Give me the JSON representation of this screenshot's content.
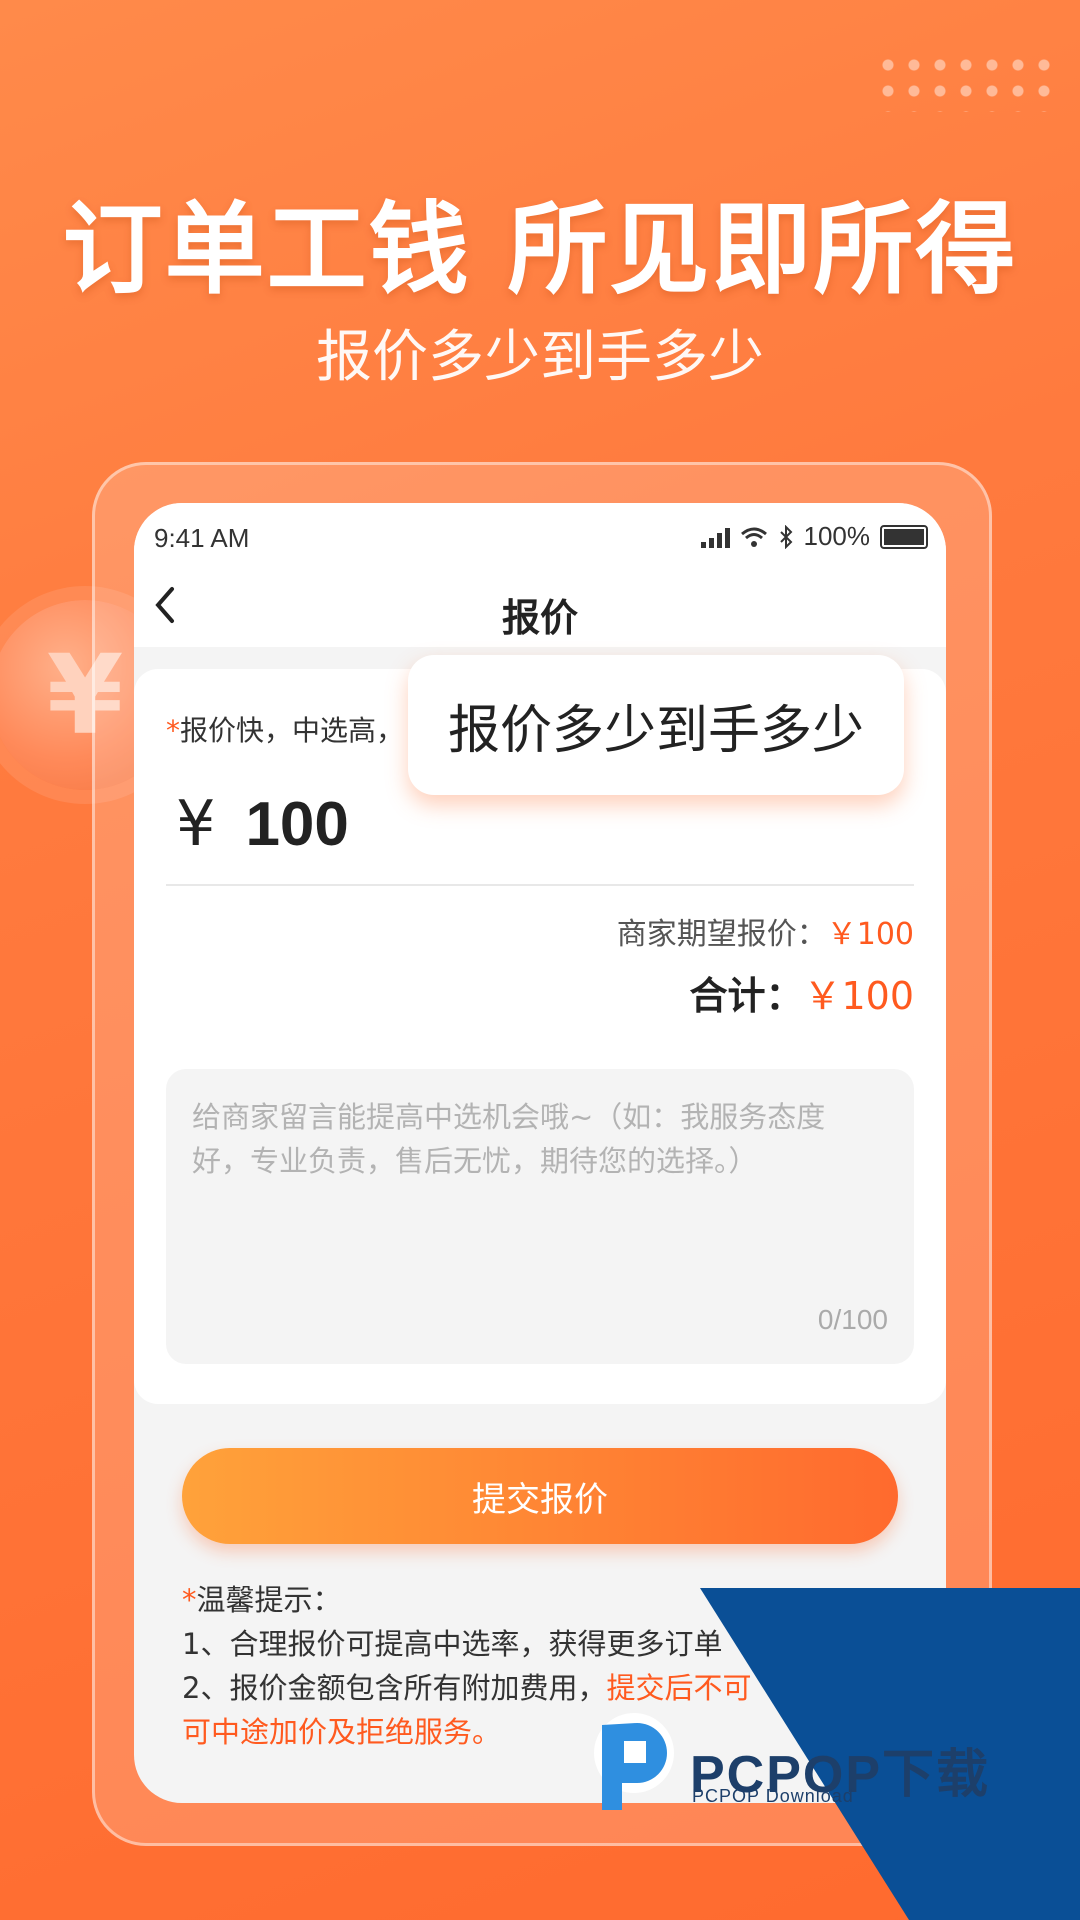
{
  "banner": {
    "headline": "订单工钱 所见即所得",
    "subheadline": "报价多少到手多少",
    "coin_symbol": "¥"
  },
  "status_bar": {
    "time": "9:41 AM",
    "battery": "100%"
  },
  "navbar": {
    "back_icon": "chevron-left-icon",
    "title": "报价"
  },
  "quote_form": {
    "required_mark": "*",
    "hint": "报价快，中选高，",
    "popup": "报价多少到手多少",
    "currency_symbol": "¥",
    "amount": "100",
    "expected_label": "商家期望报价：",
    "expected_value": "￥100",
    "total_label": "合计：",
    "total_value": "￥100",
    "note_placeholder": "给商家留言能提高中选机会哦~（如：我服务态度好，专业负责，售后无忧，期待您的选择。）",
    "note_counter": "0/100"
  },
  "submit_label": "提交报价",
  "tips": {
    "required_mark": "*",
    "title": "温馨提示：",
    "line1": "1、合理报价可提高中选率，获得更多订单",
    "line2_plain": "2、报价金额包含所有附加费用，",
    "line2_warn": "提交后不可",
    "line3_warn": "可中途加价及拒绝服务。"
  },
  "watermark": {
    "brand": "PCPOP下载",
    "sub": "PCPOP Download"
  },
  "colors": {
    "accent": "#ff5a1f",
    "background": "#ff7a3e",
    "button_start": "#ffa23a",
    "button_end": "#ff6a2e",
    "watermark_blue": "#0a4f96"
  }
}
